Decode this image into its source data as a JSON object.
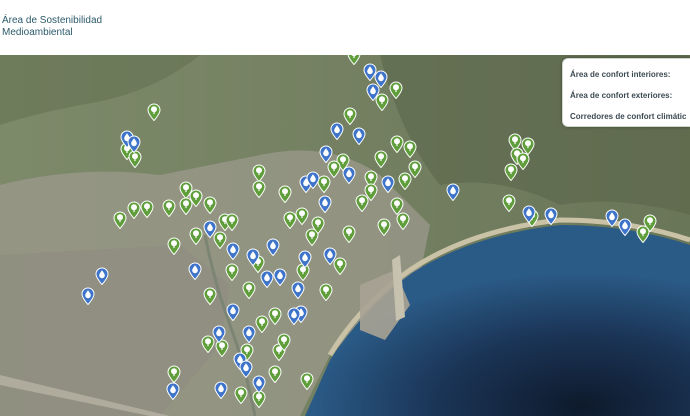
{
  "header": {
    "title_line1": "Área de Sostenibilidad",
    "title_line2": "Medioambiental"
  },
  "legend": {
    "items": [
      {
        "label": "Área de confort interiores:"
      },
      {
        "label": "Área de confort exteriores:"
      },
      {
        "label": "Corredores de confort climátic"
      }
    ]
  },
  "colors": {
    "interior_marker": "#3d73c9",
    "exterior_marker": "#5f9e3a",
    "title_text": "#2c5a6b",
    "sea": "#1f3f66"
  },
  "icons": {
    "interior": "drop-icon",
    "exterior": "tree-icon"
  }
}
